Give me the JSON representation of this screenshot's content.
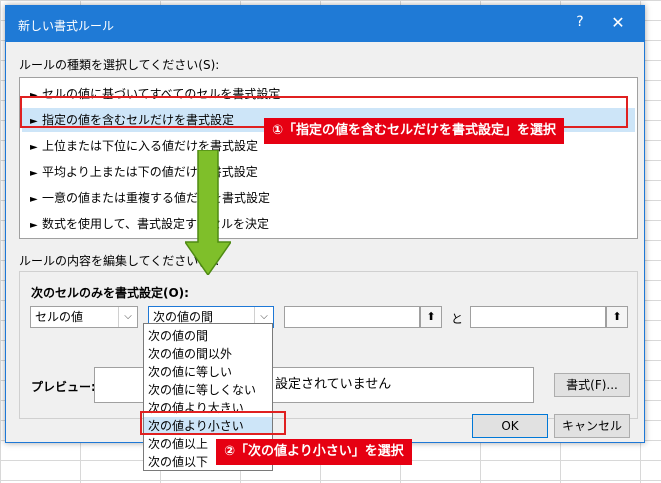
{
  "dialog": {
    "title": "新しい書式ルール",
    "help_label": "?",
    "close_label": "✕",
    "rule_type_label": "ルールの種類を選択してください(S):",
    "rule_types": [
      "セルの値に基づいてすべてのセルを書式設定",
      "指定の値を含むセルだけを書式設定",
      "上位または下位に入る値だけを書式設定",
      "平均より上または下の値だけを書式設定",
      "一意の値または重複する値だけを書式設定",
      "数式を使用して、書式設定するセルを決定"
    ],
    "rule_arrow": "►",
    "edit_label": "ルールの内容を編集してください(E):",
    "format_only_label": "次のセルのみを書式設定(O):",
    "condition_type": "セルの値",
    "operator": "次の値の間",
    "and_label": "と",
    "upload_glyph": "⬆",
    "preview_label": "プレビュー:",
    "preview_text": "設定されていません",
    "format_button": "書式(F)...",
    "ok_button": "OK",
    "cancel_button": "キャンセル",
    "dropdown_arrow": "⌵"
  },
  "operator_options": [
    "次の値の間",
    "次の値の間以外",
    "次の値に等しい",
    "次の値に等しくない",
    "次の値より大きい",
    "次の値より小さい",
    "次の値以上",
    "次の値以下"
  ],
  "annotations": {
    "callout1": "①「指定の値を含むセルだけを書式設定」を選択",
    "callout2": "②「次の値より小さい」を選択",
    "highlight_color": "#e60012",
    "arrow_color": "#7fbf2a"
  }
}
